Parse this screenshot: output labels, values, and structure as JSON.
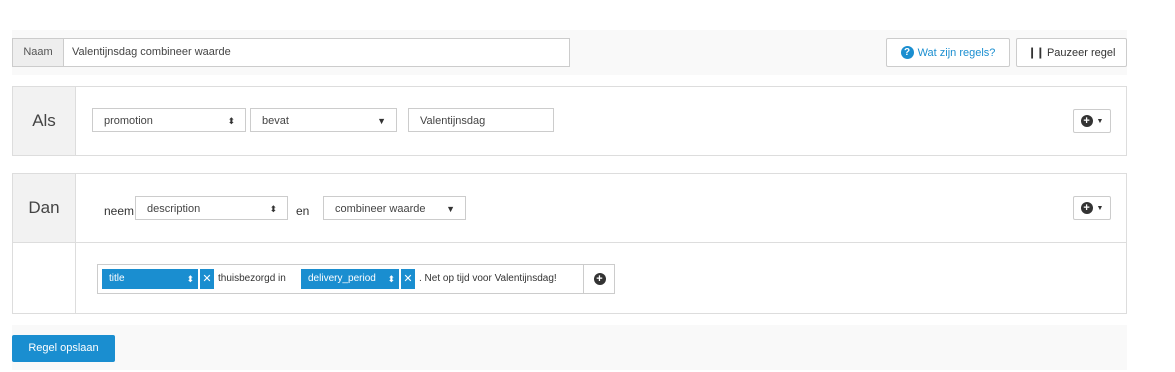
{
  "rule_name": {
    "label": "Naam",
    "value": "Valentijnsdag combineer waarde"
  },
  "header_buttons": {
    "help_label": "Wat zijn regels?",
    "pause_label": "Pauzeer regel"
  },
  "condition": {
    "label": "Als",
    "field": "promotion",
    "operator": "bevat",
    "value": "Valentijnsdag"
  },
  "action": {
    "label": "Dan",
    "take_word": "neem",
    "field": "description",
    "and_word": "en",
    "mode": "combineer waarde"
  },
  "template": {
    "chip1": "title",
    "text1": "thuisbezorgd in",
    "chip2": "delivery_period",
    "text2": ". Net op tijd voor Valentijnsdag!"
  },
  "save_label": "Regel opslaan",
  "colors": {
    "accent": "#1a8ed0"
  }
}
